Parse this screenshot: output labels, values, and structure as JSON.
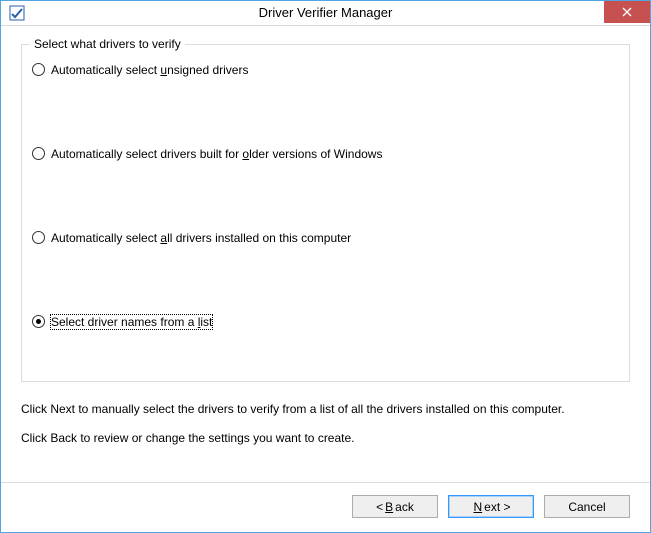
{
  "titlebar": {
    "title": "Driver Verifier Manager"
  },
  "group": {
    "legend": "Select what drivers to verify"
  },
  "options": [
    {
      "pre": "Automatically select ",
      "mn": "u",
      "post": "nsigned drivers",
      "selected": false
    },
    {
      "pre": "Automatically select drivers built for ",
      "mn": "o",
      "post": "lder versions of Windows",
      "selected": false
    },
    {
      "pre": "Automatically select ",
      "mn": "a",
      "post": "ll drivers installed on this computer",
      "selected": false
    },
    {
      "pre": "Select driver names from a ",
      "mn": "l",
      "post": "ist",
      "selected": true
    }
  ],
  "description": {
    "line1": "Click Next to manually select the drivers to verify from a list of all the drivers installed on this computer.",
    "line2": "Click Back to review or change the settings you want to create."
  },
  "buttons": {
    "back": {
      "pre": "< ",
      "mn": "B",
      "post": "ack"
    },
    "next": {
      "pre": "",
      "mn": "N",
      "post": "ext >"
    },
    "cancel": {
      "pre": "",
      "mn": "",
      "post": "Cancel"
    }
  }
}
